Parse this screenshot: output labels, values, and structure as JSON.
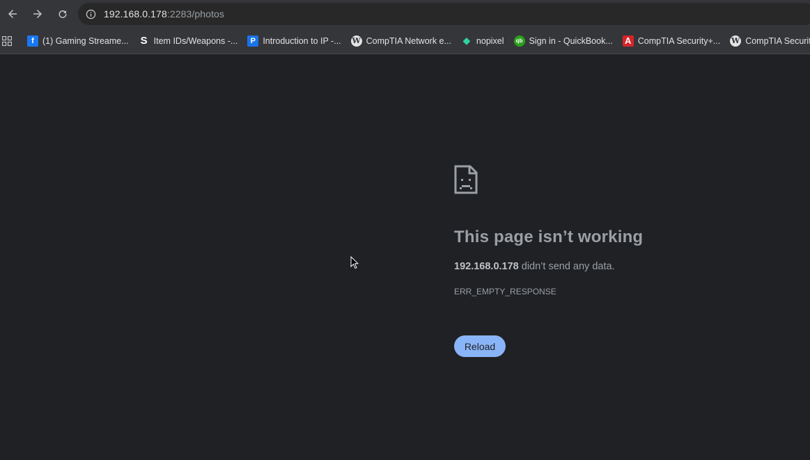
{
  "address_bar": {
    "url_host": "192.168.0.178",
    "url_rest": ":2283/photos"
  },
  "icons": {
    "back": "back-arrow-icon",
    "forward": "forward-arrow-icon",
    "reload": "reload-icon",
    "site_info": "info-icon",
    "apps": "apps-grid-icon"
  },
  "bookmarks": [
    {
      "label": "(1) Gaming Streame...",
      "icon": "facebook-icon"
    },
    {
      "label": "Item IDs/Weapons -...",
      "icon": "s-logo-icon"
    },
    {
      "label": "Introduction to IP -...",
      "icon": "p-logo-icon"
    },
    {
      "label": "CompTIA Network e...",
      "icon": "wordpress-icon"
    },
    {
      "label": "nopixel",
      "icon": "nopixel-icon"
    },
    {
      "label": "Sign in - QuickBook...",
      "icon": "quickbooks-icon"
    },
    {
      "label": "CompTIA Security+...",
      "icon": "a-logo-icon"
    },
    {
      "label": "CompTIA Security",
      "icon": "wordpress-icon"
    }
  ],
  "error": {
    "title": "This page isn’t working",
    "host": "192.168.0.178",
    "message": " didn’t send any data.",
    "code": "ERR_EMPTY_RESPONSE",
    "reload_label": "Reload"
  },
  "colors": {
    "page_background": "#202124",
    "toolbar_background": "#35363a",
    "reload_button": "#8ab4f8",
    "error_text": "#9aa0a6"
  }
}
